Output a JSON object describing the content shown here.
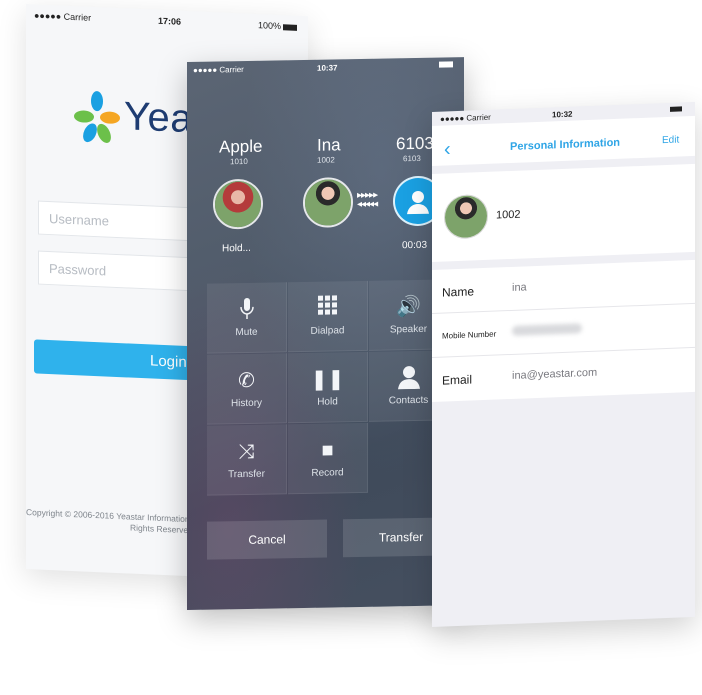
{
  "login_screen": {
    "status_bar": {
      "carrier": "●●●●● Carrier",
      "time": "17:06",
      "battery": "100%"
    },
    "logo_text": "Yea",
    "username_placeholder": "Username",
    "password_placeholder": "Password",
    "login_button": "Login",
    "copyright_line1": "Copyright © 2006-2016 Yeastar Information",
    "copyright_line2": "Rights Reserved."
  },
  "call_screen": {
    "status_bar": {
      "carrier": "●●●●● Carrier",
      "time": "10:37"
    },
    "parties": [
      {
        "name": "Apple",
        "number": "1010",
        "status": "Hold..."
      },
      {
        "name": "Ina",
        "number": "1002",
        "status": ""
      },
      {
        "name": "6103",
        "number": "6103",
        "status": "00:03"
      }
    ],
    "controls": [
      {
        "label": "Mute",
        "icon": "mic-icon"
      },
      {
        "label": "Dialpad",
        "icon": "dialpad-icon"
      },
      {
        "label": "Speaker",
        "icon": "speaker-icon"
      },
      {
        "label": "History",
        "icon": "history-icon"
      },
      {
        "label": "Hold",
        "icon": "pause-icon"
      },
      {
        "label": "Contacts",
        "icon": "contact-icon"
      },
      {
        "label": "Transfer",
        "icon": "transfer-icon"
      },
      {
        "label": "Record",
        "icon": "record-icon"
      }
    ],
    "cancel_button": "Cancel",
    "transfer_button": "Transfer"
  },
  "info_screen": {
    "status_bar": {
      "carrier": "●●●●● Carrier",
      "time": "10:32"
    },
    "title": "Personal Information",
    "edit": "Edit",
    "extension": "1002",
    "fields": {
      "name_label": "Name",
      "name_value": "ina",
      "mobile_label": "Mobile Number",
      "email_label": "Email",
      "email_value": "ina@yeastar.com"
    }
  },
  "colors": {
    "accent": "#2fb2ec",
    "brand_blue": "#1e3c72",
    "call_bg": "#4d5868"
  }
}
